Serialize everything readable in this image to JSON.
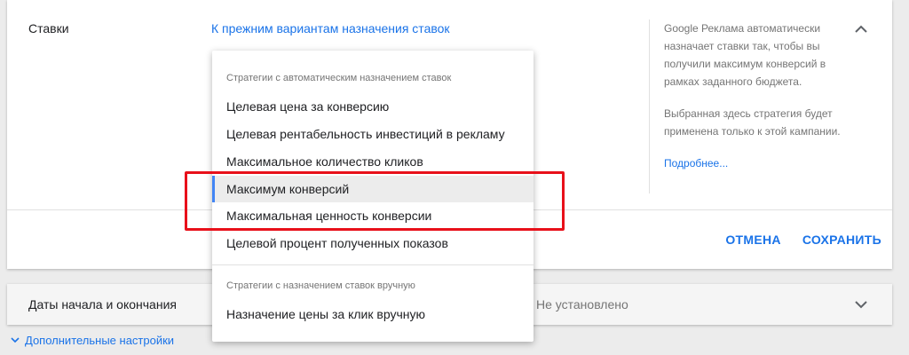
{
  "bids_panel": {
    "label": "Ставки",
    "back_link": "К прежним вариантам назначения ставок",
    "help_text_1": "Google Реклама автоматически назначает ставки так, чтобы вы получили максимум конверсий в рамках заданного бюджета.",
    "help_text_2": "Выбранная здесь стратегия будет применена только к этой кампании.",
    "help_link": "Подробнее...",
    "cancel_label": "ОТМЕНА",
    "save_label": "СОХРАНИТЬ"
  },
  "dates_panel": {
    "label": "Даты начала и окончания",
    "value": "Не установлено"
  },
  "more_settings": {
    "label": "Дополнительные настройки"
  },
  "dropdown": {
    "auto_header": "Стратегии с автоматическим назначением ставок",
    "auto_items": [
      {
        "label": "Целевая цена за конверсию"
      },
      {
        "label": "Целевая рентабельность инвестиций в рекламу"
      },
      {
        "label": "Максимальное количество кликов"
      },
      {
        "label": "Максимум конверсий",
        "selected": true
      },
      {
        "label": "Максимальная ценность конверсии"
      },
      {
        "label": "Целевой процент полученных показов"
      }
    ],
    "manual_header": "Стратегии с назначением ставок вручную",
    "manual_items": [
      {
        "label": "Назначение цены за клик вручную"
      }
    ]
  },
  "colors": {
    "link": "#1a73e8",
    "selected_accent": "#4285f4",
    "highlight": "#e8101a"
  }
}
